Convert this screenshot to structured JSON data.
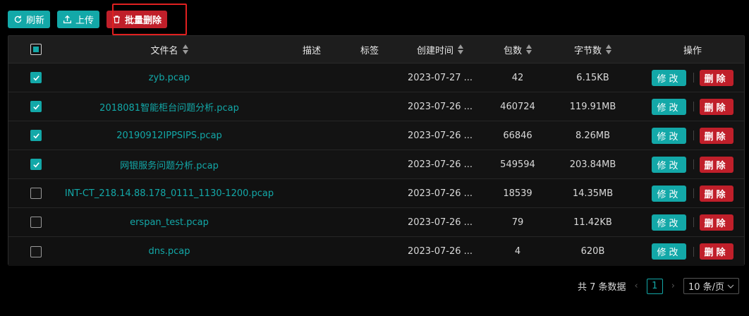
{
  "toolbar": {
    "refresh_label": "刷新",
    "upload_label": "上传",
    "batch_delete_label": "批量删除"
  },
  "table": {
    "columns": {
      "name": "文件名",
      "desc": "描述",
      "tag": "标签",
      "created": "创建时间",
      "packets": "包数",
      "bytes": "字节数",
      "ops": "操作"
    },
    "edit_label": "修改",
    "delete_label": "删除",
    "rows": [
      {
        "name": "zyb.pcap",
        "desc": "",
        "tag": "",
        "created": "2023-07-27 ...",
        "packets": "42",
        "bytes": "6.15KB",
        "checked": true
      },
      {
        "name": "2018081智能柜台问题分析.pcap",
        "desc": "",
        "tag": "",
        "created": "2023-07-26 ...",
        "packets": "460724",
        "bytes": "119.91MB",
        "checked": true
      },
      {
        "name": "20190912IPPSIPS.pcap",
        "desc": "",
        "tag": "",
        "created": "2023-07-26 ...",
        "packets": "66846",
        "bytes": "8.26MB",
        "checked": true
      },
      {
        "name": "网银服务问题分析.pcap",
        "desc": "",
        "tag": "",
        "created": "2023-07-26 ...",
        "packets": "549594",
        "bytes": "203.84MB",
        "checked": true
      },
      {
        "name": "INT-CT_218.14.88.178_0111_1130-1200.pcap",
        "desc": "",
        "tag": "",
        "created": "2023-07-26 ...",
        "packets": "18539",
        "bytes": "14.35MB",
        "checked": false
      },
      {
        "name": "erspan_test.pcap",
        "desc": "",
        "tag": "",
        "created": "2023-07-26 ...",
        "packets": "79",
        "bytes": "11.42KB",
        "checked": false
      },
      {
        "name": "dns.pcap",
        "desc": "",
        "tag": "",
        "created": "2023-07-26 ...",
        "packets": "4",
        "bytes": "620B",
        "checked": false
      }
    ]
  },
  "pagination": {
    "total_label": "共 7 条数据",
    "current_page": "1",
    "page_size_label": "10 条/页"
  },
  "colors": {
    "accent": "#13a8a8",
    "danger": "#c01f2a",
    "highlight_outline": "#e02020"
  }
}
